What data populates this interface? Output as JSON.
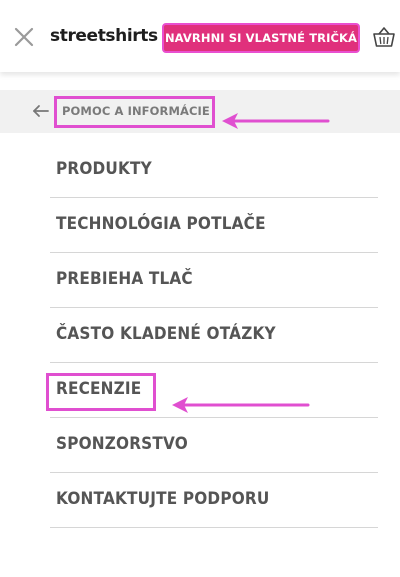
{
  "header": {
    "logo_text": "streetshirts",
    "cta_label": "NAVRHNI SI VLASTNÉ TRIČKÁ",
    "close_icon": "close-icon",
    "cart_icon": "basket-icon"
  },
  "back": {
    "label": "POMOC A INFORMÁCIE",
    "icon": "back-arrow-icon"
  },
  "menu": {
    "items": [
      {
        "label": "PRODUKTY"
      },
      {
        "label": "TECHNOLÓGIA POTLAČE"
      },
      {
        "label": "PREBIEHA TLAČ"
      },
      {
        "label": "ČASTO KLADENÉ OTÁZKY"
      },
      {
        "label": "RECENZIE"
      },
      {
        "label": "SPONZORSTVO"
      },
      {
        "label": "KONTAKTUJTE PODPORU"
      }
    ]
  },
  "colors": {
    "brand_pink": "#e0307c",
    "annotation_magenta": "#e04fd0",
    "menu_text": "#555555",
    "back_row_bg": "#f1f1f1"
  }
}
